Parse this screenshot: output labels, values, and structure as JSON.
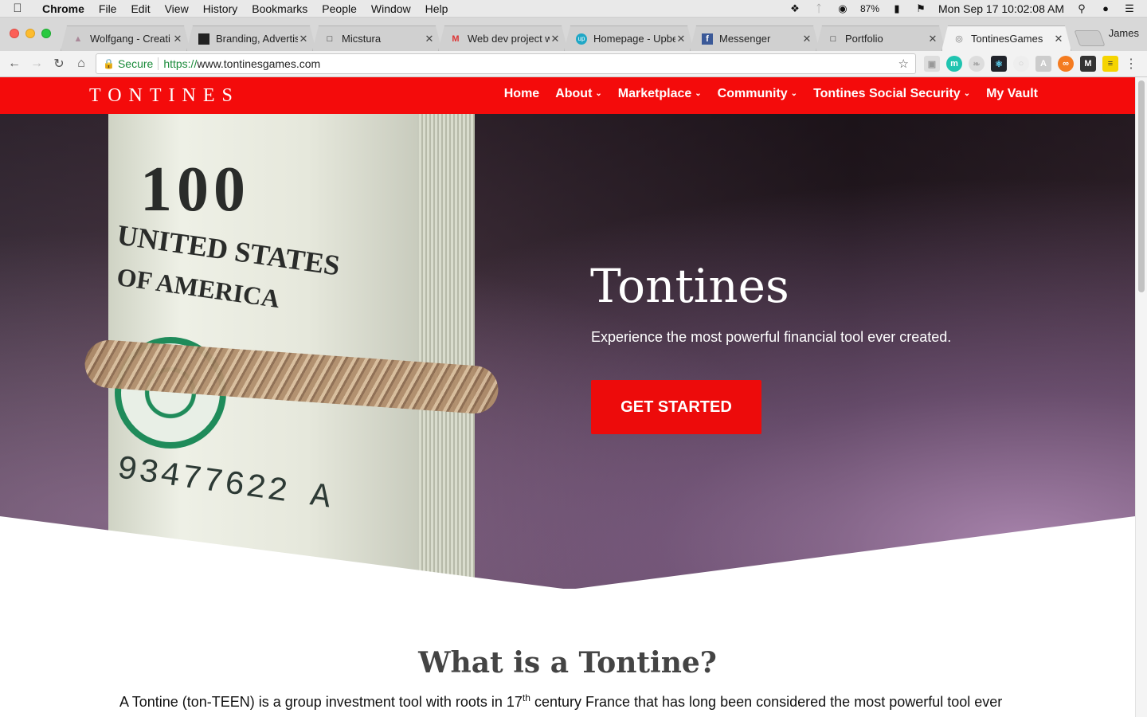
{
  "menubar": {
    "app": "Chrome",
    "items": [
      "File",
      "Edit",
      "View",
      "History",
      "Bookmarks",
      "People",
      "Window",
      "Help"
    ],
    "battery": "87%",
    "datetime": "Mon Sep 17  10:02:08 AM"
  },
  "tabs": [
    {
      "label": "Wolfgang - Creati",
      "active": false
    },
    {
      "label": "Branding, Advertis",
      "active": false
    },
    {
      "label": "Micstura",
      "active": false
    },
    {
      "label": "Web dev project w",
      "active": false
    },
    {
      "label": "Homepage - Upbe",
      "active": false
    },
    {
      "label": "Messenger",
      "active": false
    },
    {
      "label": "Portfolio",
      "active": false
    },
    {
      "label": "TontinesGames",
      "active": true
    }
  ],
  "profile_name": "James",
  "address": {
    "secure_label": "Secure",
    "scheme": "https://",
    "host": "www.tontinesgames.com"
  },
  "site": {
    "logo": "TONTINES",
    "nav": [
      {
        "label": "Home",
        "dropdown": false
      },
      {
        "label": "About",
        "dropdown": true
      },
      {
        "label": "Marketplace",
        "dropdown": true
      },
      {
        "label": "Community",
        "dropdown": true
      },
      {
        "label": "Tontines Social Security",
        "dropdown": true
      },
      {
        "label": "My Vault",
        "dropdown": false
      }
    ],
    "hero": {
      "title": "Tontines",
      "subtitle": "Experience the most powerful financial tool ever created.",
      "cta": "GET STARTED",
      "bill_serial": "93477622 A",
      "bill_number": "100",
      "bill_text_1": "UNITED STATES",
      "bill_text_2": "OF AMERICA"
    },
    "section": {
      "title": "What is a Tontine?",
      "body_pre": "A Tontine (ton-TEEN) is a group investment tool with roots in 17",
      "body_sup": "th",
      "body_post": " century France that has long been considered the most powerful tool ever"
    },
    "brand_color": "#f40b0b"
  }
}
